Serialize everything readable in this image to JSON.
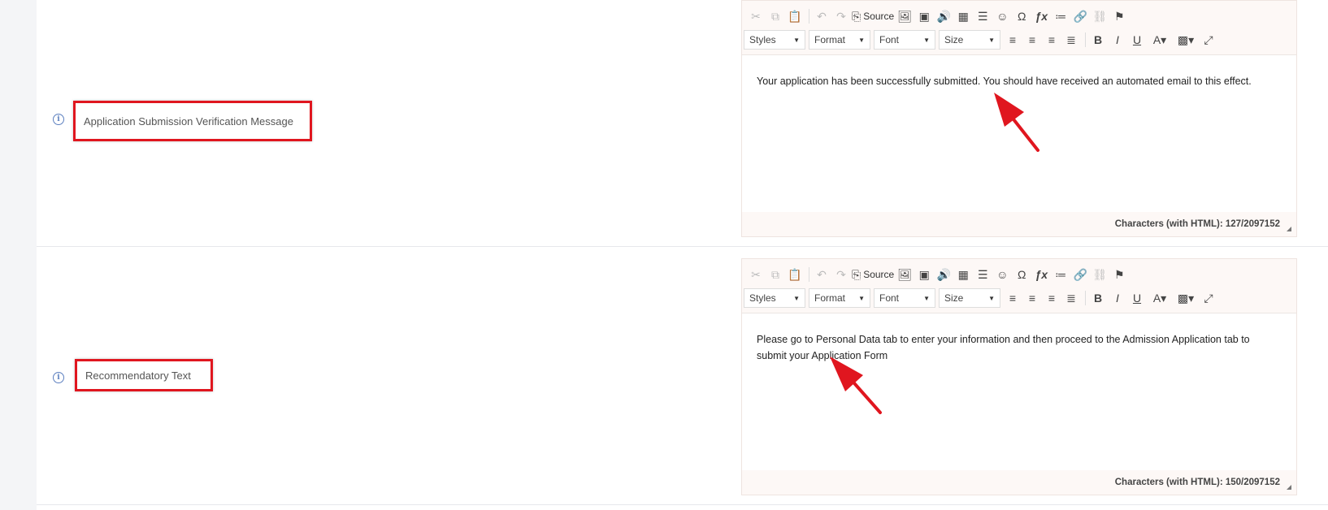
{
  "toolbar": {
    "source_label": "Source",
    "combos": [
      "Styles",
      "Format",
      "Font",
      "Size"
    ]
  },
  "fields": [
    {
      "label": "Application Submission Verification Message",
      "content": "Your  application has been successfully submitted. You should have received an automated email to this effect.",
      "counter": "Characters (with HTML): 127/2097152"
    },
    {
      "label": "Recommendatory Text",
      "content": "Please go to Personal Data tab to enter your information and then proceed to the Admission Application tab to submit your Application Form",
      "counter": "Characters (with HTML): 150/2097152"
    }
  ],
  "colors": {
    "highlight": "#e0161f",
    "info_icon": "#5b7fbf"
  }
}
